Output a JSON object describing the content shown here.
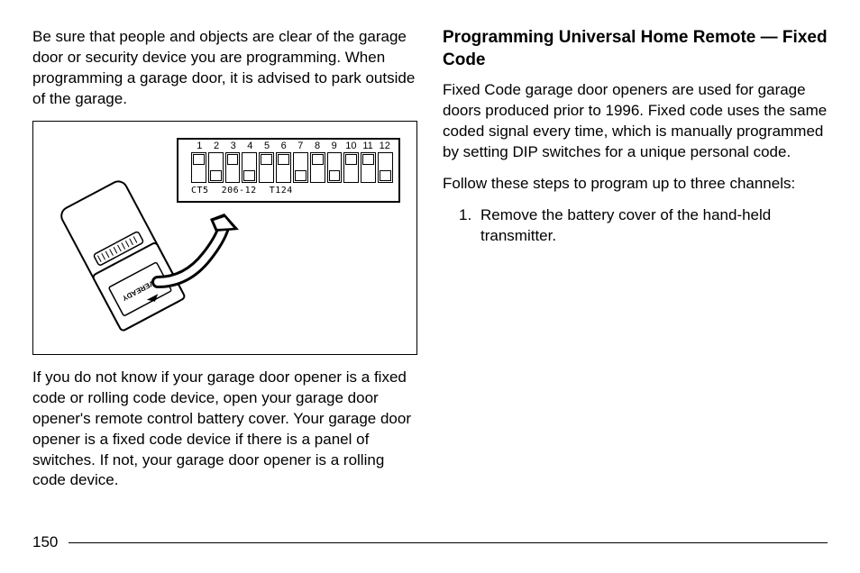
{
  "left": {
    "para1": "Be sure that people and objects are clear of the garage door or security device you are programming. When programming a garage door, it is advised to park outside of the garage.",
    "para2": "If you do not know if your garage door opener is a fixed code or rolling code device, open your garage door opener's remote control battery cover. Your garage door opener is a fixed code device if there is a panel of switches. If not, your garage door opener is a rolling code device."
  },
  "right": {
    "heading": "Programming Universal Home Remote — Fixed Code",
    "para1": "Fixed Code garage door openers are used for garage doors produced prior to 1996. Fixed code uses the same coded signal every time, which is manually programmed by setting DIP switches for a unique personal code.",
    "para2": "Follow these steps to program up to three channels:",
    "step1_num": "1.",
    "step1_text": "Remove the battery cover of the hand-held transmitter."
  },
  "figure": {
    "dip_numbers": [
      "1",
      "2",
      "3",
      "4",
      "5",
      "6",
      "7",
      "8",
      "9",
      "10",
      "11",
      "12"
    ],
    "dip_label_1": "CT5",
    "dip_label_2": "206-12",
    "dip_label_3": "T124",
    "battery_brand": "EVEREADY"
  },
  "page_number": "150"
}
